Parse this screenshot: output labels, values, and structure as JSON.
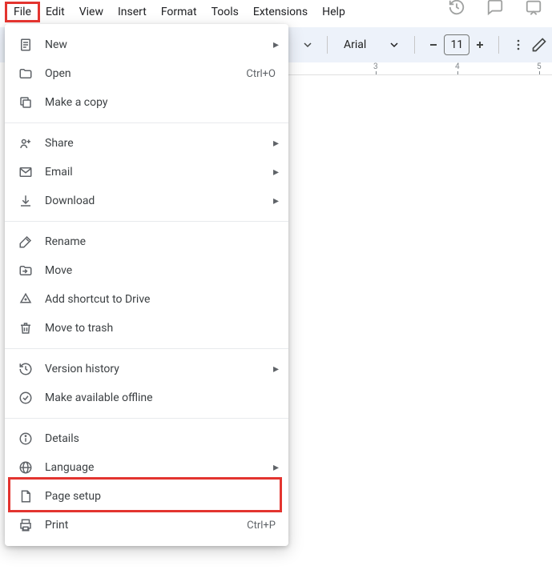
{
  "menubar": {
    "items": [
      "File",
      "Edit",
      "View",
      "Insert",
      "Format",
      "Tools",
      "Extensions",
      "Help"
    ]
  },
  "toolbar": {
    "font": "Arial",
    "font_size": "11"
  },
  "ruler": {
    "marks": [
      "3",
      "4",
      "5"
    ]
  },
  "file_menu": {
    "groups": [
      [
        {
          "icon": "doc",
          "label": "New",
          "submenu": true
        },
        {
          "icon": "folder",
          "label": "Open",
          "shortcut": "Ctrl+O"
        },
        {
          "icon": "copy",
          "label": "Make a copy"
        }
      ],
      [
        {
          "icon": "share",
          "label": "Share",
          "submenu": true
        },
        {
          "icon": "mail",
          "label": "Email",
          "submenu": true
        },
        {
          "icon": "download",
          "label": "Download",
          "submenu": true
        }
      ],
      [
        {
          "icon": "rename",
          "label": "Rename"
        },
        {
          "icon": "move",
          "label": "Move"
        },
        {
          "icon": "drive-shortcut",
          "label": "Add shortcut to Drive"
        },
        {
          "icon": "trash",
          "label": "Move to trash"
        }
      ],
      [
        {
          "icon": "history",
          "label": "Version history",
          "submenu": true
        },
        {
          "icon": "offline",
          "label": "Make available offline"
        }
      ],
      [
        {
          "icon": "info",
          "label": "Details"
        },
        {
          "icon": "globe",
          "label": "Language",
          "submenu": true
        },
        {
          "icon": "page",
          "label": "Page setup"
        },
        {
          "icon": "print",
          "label": "Print",
          "shortcut": "Ctrl+P"
        }
      ]
    ]
  }
}
